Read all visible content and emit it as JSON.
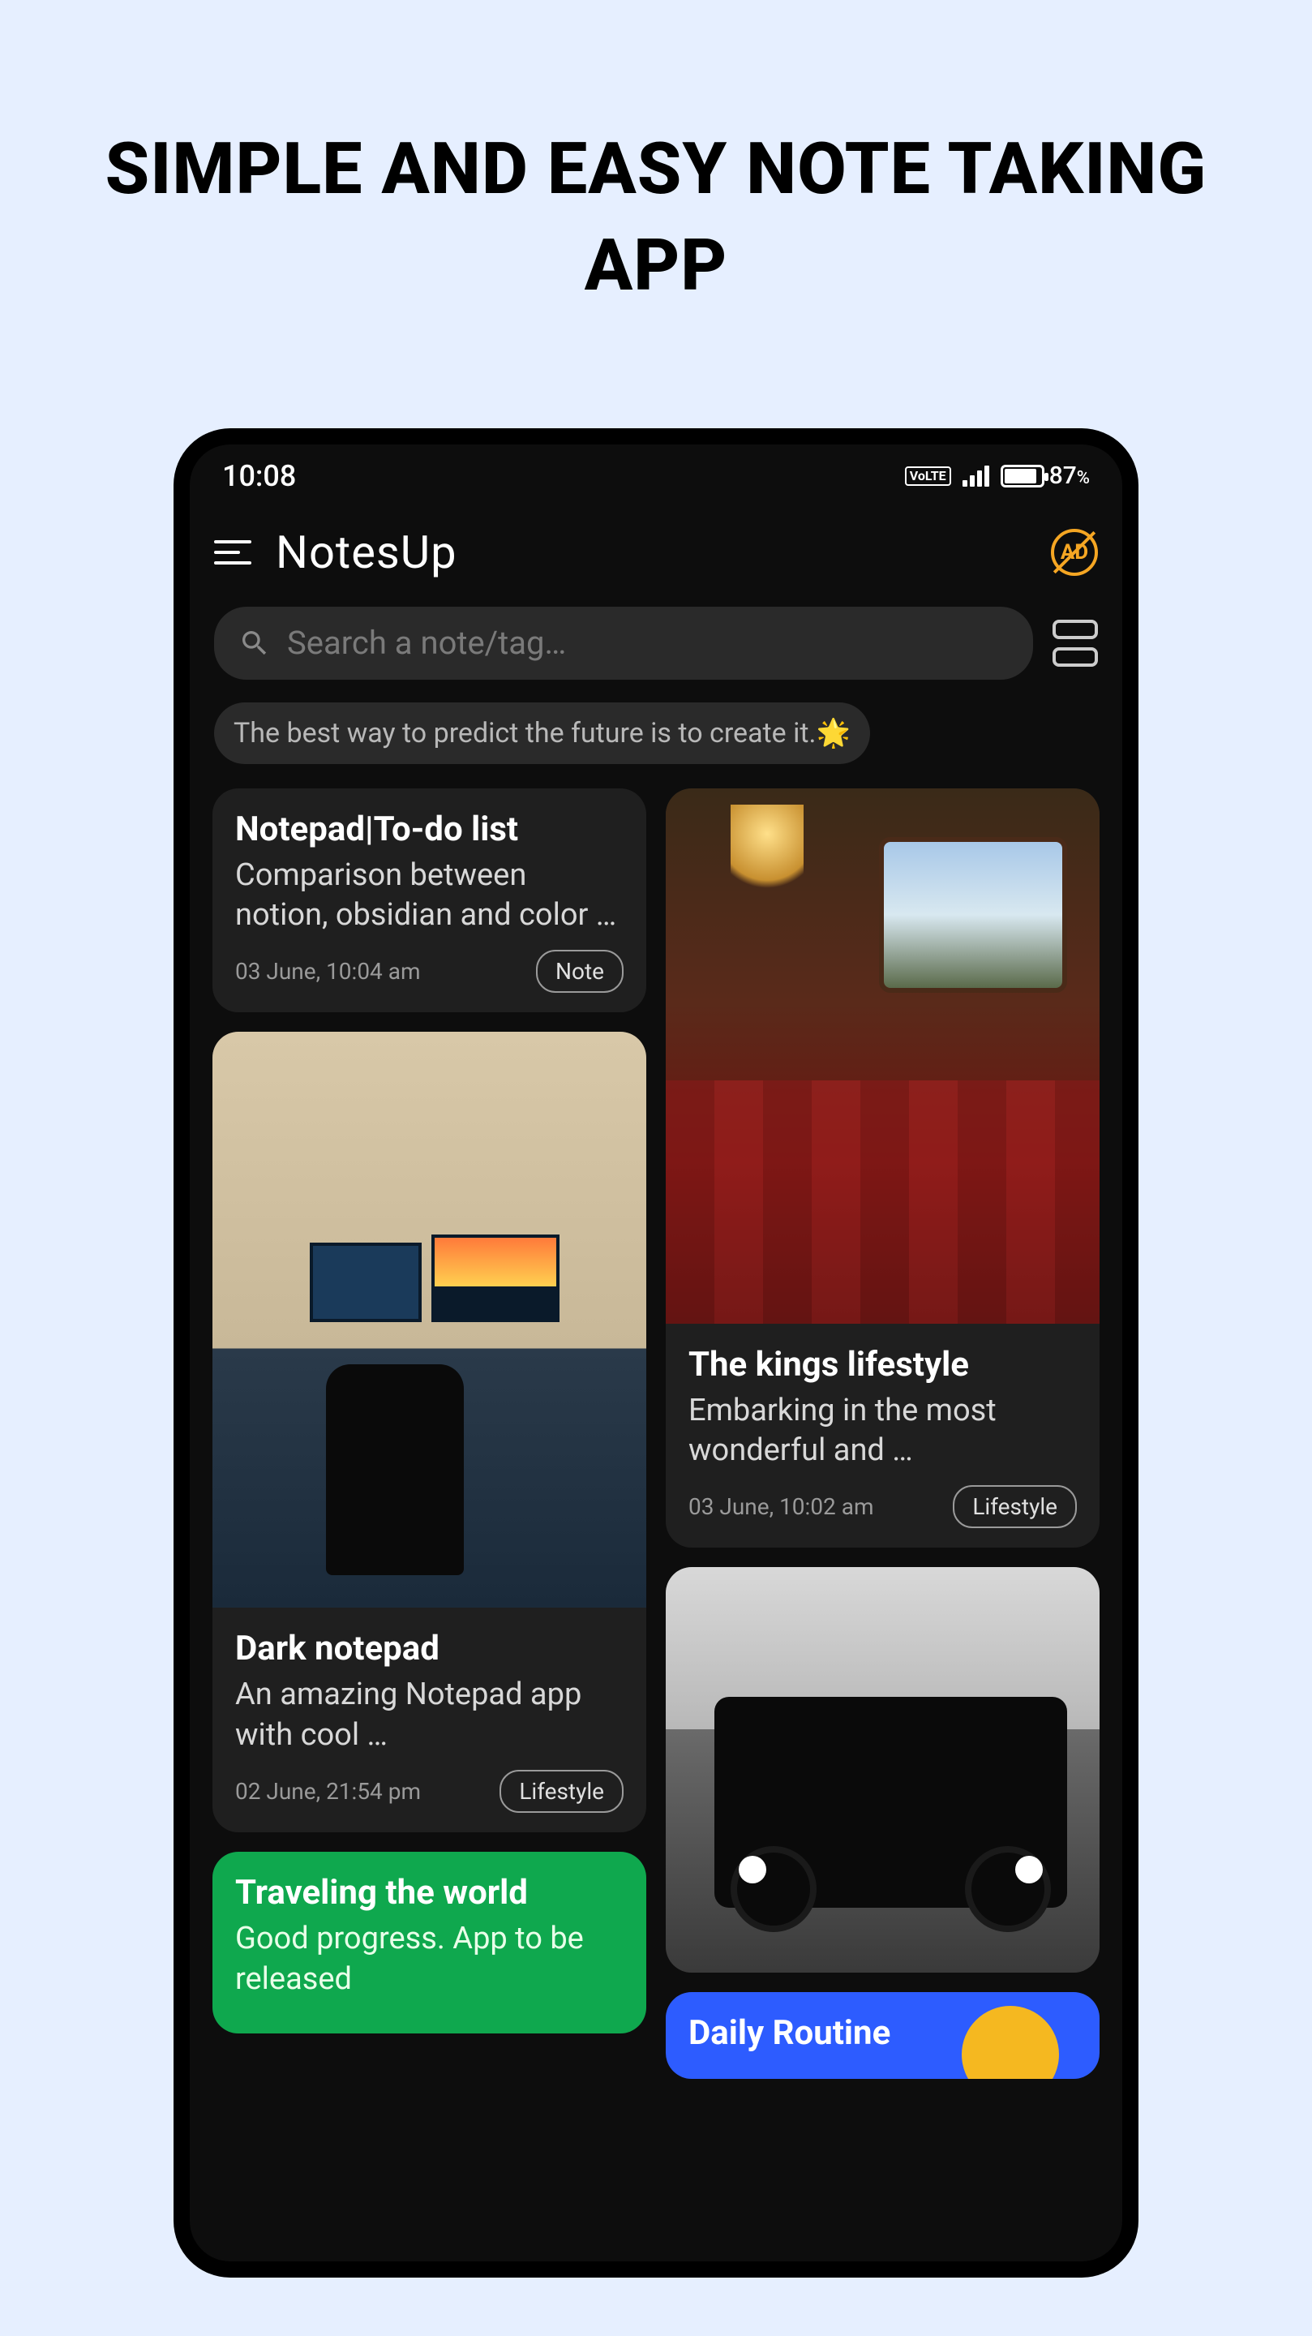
{
  "headline": "SIMPLE AND EASY NOTE TAKING APP",
  "statusbar": {
    "time": "10:08",
    "volte": "VoLTE",
    "battery_pct": "87",
    "battery_suffix": "%"
  },
  "appbar": {
    "title": "NotesUp",
    "ad_label": "AD"
  },
  "search": {
    "placeholder": "Search a note/tag…"
  },
  "quote": "The best way to predict the future is to create it.🌟",
  "notes": {
    "notepad_todo": {
      "title": "Notepad|To-do list",
      "desc": "Comparison between notion, obsidian and color …",
      "time": "03 June, 10:04 am",
      "tag": "Note"
    },
    "kings": {
      "title": "The kings lifestyle",
      "desc": "Embarking in the most wonderful and …",
      "time": "03 June, 10:02 am",
      "tag": "Lifestyle"
    },
    "dark_notepad": {
      "title": "Dark notepad",
      "desc": "An amazing Notepad app with cool …",
      "time": "02 June, 21:54 pm",
      "tag": "Lifestyle"
    },
    "traveling": {
      "title": "Traveling the world",
      "desc": "Good progress. App to be released"
    },
    "daily": {
      "title": "Daily Routine"
    }
  }
}
